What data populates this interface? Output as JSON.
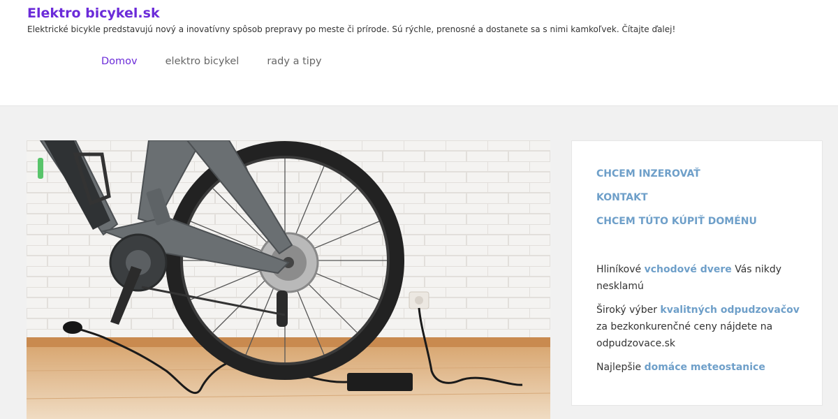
{
  "header": {
    "title": "Elektro bicykel.sk",
    "description": "Elektrické bicykle predstavujú nový a inovatívny spôsob prepravy po meste či prírode. Sú rýchle, prenosné a dostanete sa s nimi kamkoľvek. Čítajte ďalej!"
  },
  "nav": {
    "items": [
      {
        "label": "Domov",
        "active": true
      },
      {
        "label": "elektro bicykel",
        "active": false
      },
      {
        "label": "rady a tipy",
        "active": false
      }
    ]
  },
  "sidebar": {
    "links": [
      {
        "label": "Chcem inzerovať"
      },
      {
        "label": "Kontakt"
      },
      {
        "label": "Chcem túto kúpiť doménu"
      }
    ],
    "promos": [
      {
        "before": "Hliníkové ",
        "link": "vchodové dvere",
        "after": " Vás nikdy nesklamú"
      },
      {
        "before": "Široký výber ",
        "link": "kvalitných odpudzovačov",
        "after": " za bezkonkurenčné ceny nájdete na odpudzovace.sk"
      },
      {
        "before": "Najlepšie ",
        "link": "domáce meteostanice",
        "after": ""
      }
    ]
  },
  "colors": {
    "brand": "#6b2bd9",
    "link": "#6e9fc9",
    "background": "#f1f1f1"
  }
}
